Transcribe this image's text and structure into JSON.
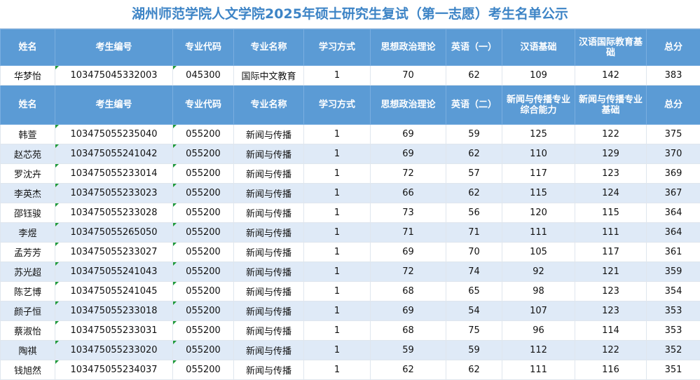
{
  "title": "湖州师范学院人文学院2025年硕士研究生复试（第一志愿）考生名单公示",
  "table1": {
    "headers": [
      "姓名",
      "考生编号",
      "专业代码",
      "专业名称",
      "学习方式",
      "思想政治理论",
      "英语（一）",
      "汉语基础",
      "汉语国际教育基础",
      "总分"
    ],
    "rows": [
      [
        "华梦怡",
        "103475045332003",
        "045300",
        "国际中文教育",
        "1",
        "70",
        "62",
        "109",
        "142",
        "383"
      ]
    ]
  },
  "table2": {
    "headers": [
      "姓名",
      "考生编号",
      "专业代码",
      "专业名称",
      "学习方式",
      "思想政治理论",
      "英语（二）",
      "新闻与传播专业综合能力",
      "新闻与传播专业基础",
      "总分"
    ],
    "rows": [
      [
        "韩萱",
        "103475055235040",
        "055200",
        "新闻与传播",
        "1",
        "69",
        "59",
        "125",
        "122",
        "375"
      ],
      [
        "赵芯苑",
        "103475055241042",
        "055200",
        "新闻与传播",
        "1",
        "69",
        "62",
        "110",
        "129",
        "370"
      ],
      [
        "罗沈卉",
        "103475055233014",
        "055200",
        "新闻与传播",
        "1",
        "72",
        "57",
        "117",
        "123",
        "369"
      ],
      [
        "李英杰",
        "103475055233023",
        "055200",
        "新闻与传播",
        "1",
        "66",
        "62",
        "115",
        "124",
        "367"
      ],
      [
        "邵钰骏",
        "103475055233028",
        "055200",
        "新闻与传播",
        "1",
        "73",
        "56",
        "120",
        "115",
        "364"
      ],
      [
        "李煜",
        "103475055265050",
        "055200",
        "新闻与传播",
        "1",
        "71",
        "71",
        "111",
        "111",
        "364"
      ],
      [
        "孟芳芳",
        "103475055233027",
        "055200",
        "新闻与传播",
        "1",
        "69",
        "70",
        "105",
        "117",
        "361"
      ],
      [
        "苏光超",
        "103475055241043",
        "055200",
        "新闻与传播",
        "1",
        "72",
        "74",
        "92",
        "121",
        "359"
      ],
      [
        "陈艺博",
        "103475055241045",
        "055200",
        "新闻与传播",
        "1",
        "68",
        "65",
        "98",
        "123",
        "354"
      ],
      [
        "颜子恒",
        "103475055233018",
        "055200",
        "新闻与传播",
        "1",
        "69",
        "54",
        "107",
        "123",
        "353"
      ],
      [
        "蔡淑怡",
        "103475055233031",
        "055200",
        "新闻与传播",
        "1",
        "68",
        "75",
        "96",
        "114",
        "353"
      ],
      [
        "陶祺",
        "103475055233020",
        "055200",
        "新闻与传播",
        "1",
        "59",
        "59",
        "112",
        "122",
        "352"
      ],
      [
        "钱旭然",
        "103475055234037",
        "055200",
        "新闻与传播",
        "1",
        "62",
        "62",
        "111",
        "116",
        "351"
      ]
    ]
  },
  "colors": {
    "header_bg": "#5b9bd5",
    "title": "#3d84c6",
    "alt_row": "#dfeaf7",
    "cell_marker": "#1f9a3a"
  }
}
